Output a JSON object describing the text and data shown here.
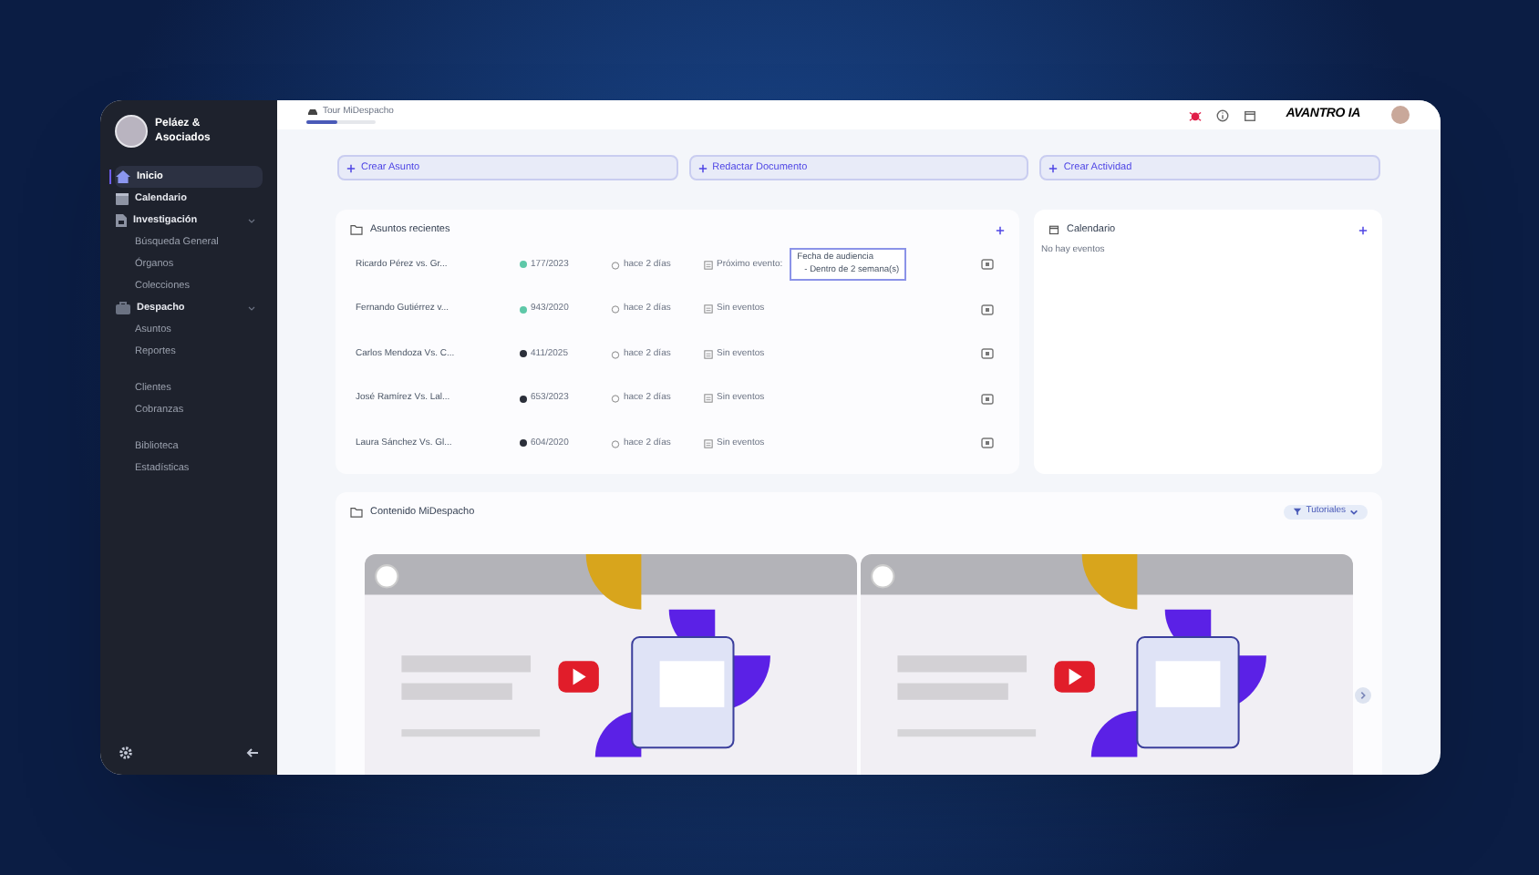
{
  "sidebar": {
    "firm": "Peláez & Asociados",
    "groups": [
      {
        "items": [
          {
            "label": "Inicio",
            "selected": true
          },
          {
            "label": "Calendario",
            "selected": false
          },
          {
            "label": "Investigación",
            "selected": false,
            "expanded": true,
            "children": [
              {
                "label": "Búsqueda General",
                "selected": false
              },
              {
                "label": "Órganos",
                "selected": false
              },
              {
                "label": "Colecciones",
                "selected": false
              }
            ]
          },
          {
            "label": "Despacho",
            "selected": false,
            "expanded": true,
            "children": [
              {
                "label": "Asuntos",
                "selected": false
              },
              {
                "label": "Reportes",
                "selected": false
              }
            ]
          }
        ]
      },
      {
        "items": [
          {
            "label": "Clientes",
            "selected": false
          },
          {
            "label": "Cobranzas",
            "selected": false
          }
        ]
      },
      {
        "items": [
          {
            "label": "Biblioteca",
            "selected": false
          },
          {
            "label": "Estadísticas",
            "selected": false
          }
        ]
      }
    ]
  },
  "topbar": {
    "tour": {
      "label": "Tour MiDespacho",
      "level": 0.45
    },
    "brand": "AVANTRO IA"
  },
  "actions": [
    "Crear Asunto",
    "Redactar Documento",
    "Crear Actividad"
  ],
  "recent": {
    "title": "Asuntos recientes",
    "rows": [
      {
        "name": "Ricardo Pérez vs. Gr...",
        "color": "#5ec8a8",
        "number": "177/2023",
        "time": "hace 2 días",
        "events": "Próximo evento:",
        "tooltip": [
          "Fecha de audiencia",
          "- Dentro de 2 semana(s)"
        ]
      },
      {
        "name": "Fernando Gutiérrez v...",
        "color": "#5ec8a8",
        "number": "943/2020",
        "time": "hace 2 días",
        "events": "Sin eventos"
      },
      {
        "name": "Carlos Mendoza Vs. C...",
        "color": "#2b2f3a",
        "number": "411/2025",
        "time": "hace 2 días",
        "events": "Sin eventos"
      },
      {
        "name": "José Ramírez Vs. Lal...",
        "color": "#2b2f3a",
        "number": "653/2023",
        "time": "hace 2 días",
        "events": "Sin eventos"
      },
      {
        "name": "Laura Sánchez Vs. Gl...",
        "color": "#2b2f3a",
        "number": "604/2020",
        "time": "hace 2 días",
        "events": "Sin eventos"
      }
    ]
  },
  "calendar": {
    "title": "Calendario",
    "empty": "No hay eventos"
  },
  "content": {
    "title": "Contenido MiDespacho",
    "filter": "Tutoriales"
  }
}
